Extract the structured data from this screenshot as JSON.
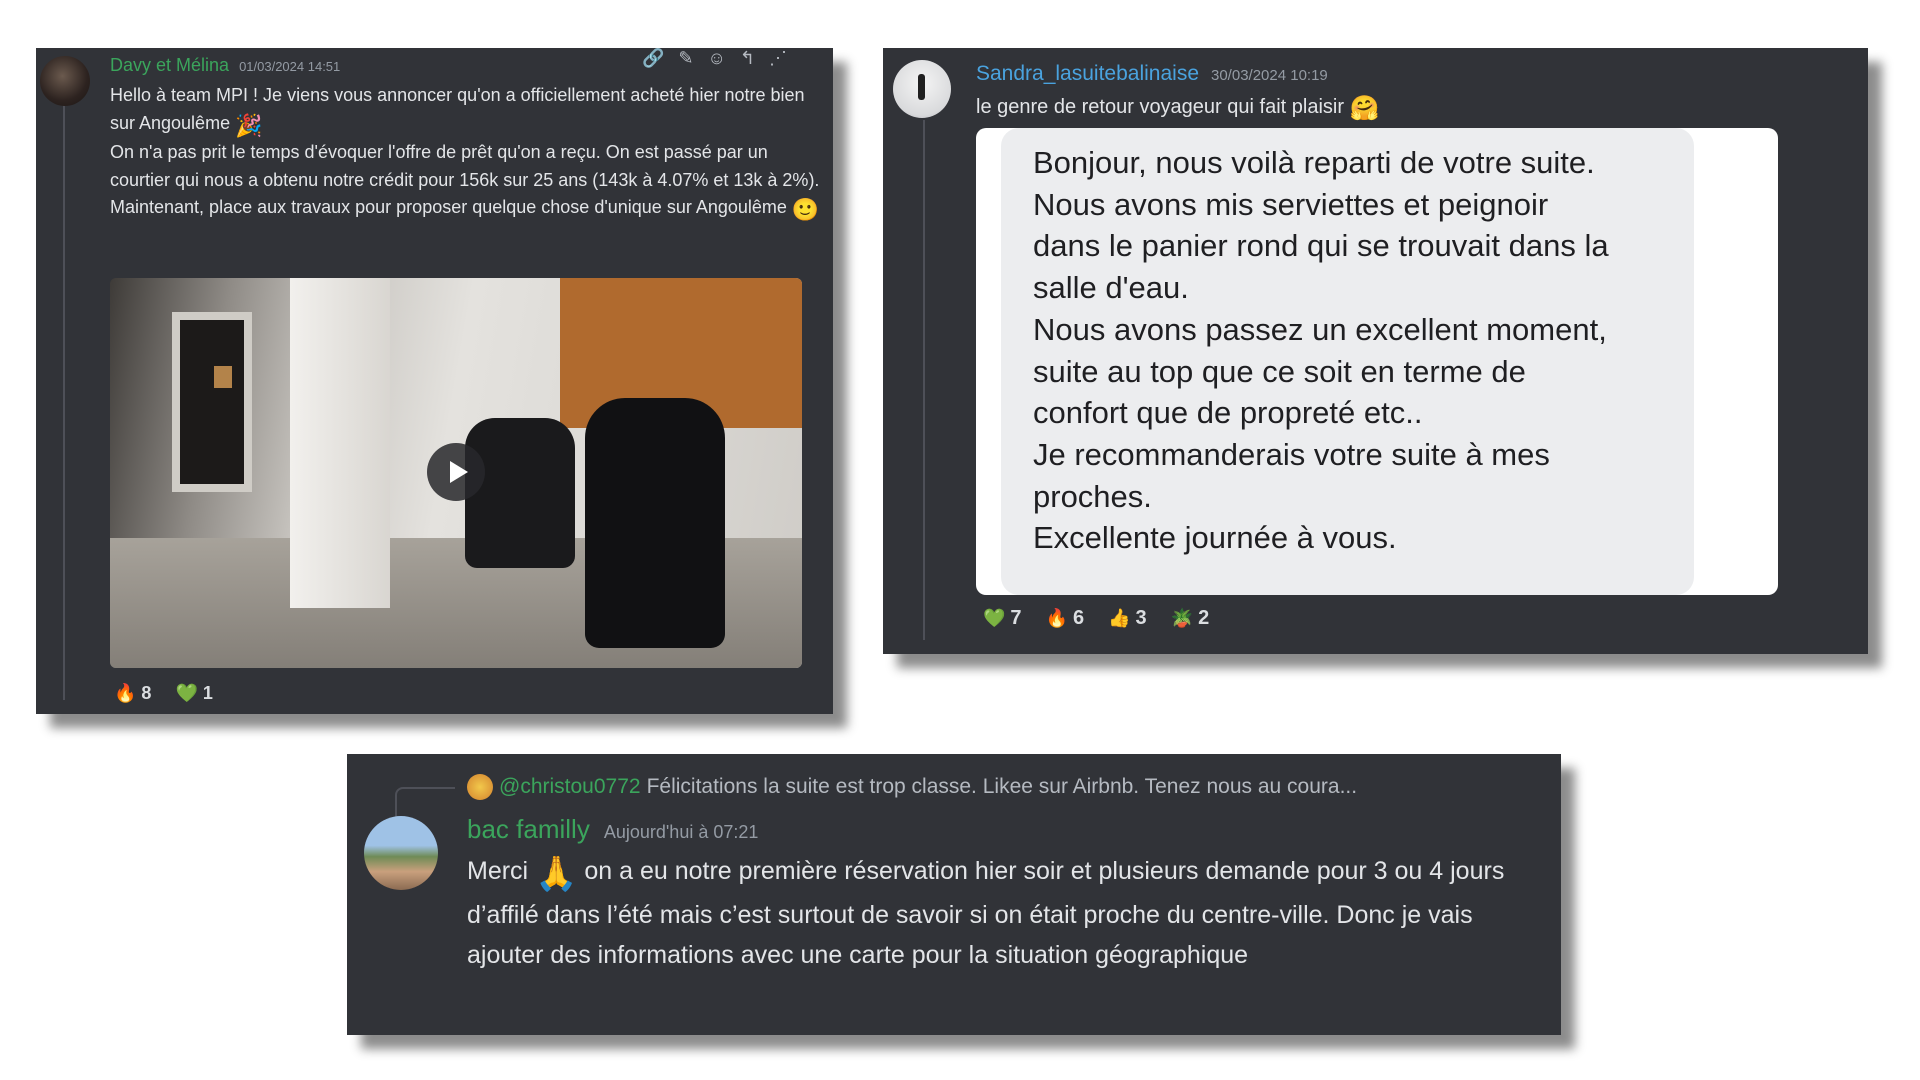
{
  "card1": {
    "author": "Davy et Mélina",
    "timestamp": "01/03/2024 14:51",
    "paragraphs": [
      "Hello à team MPI ! Je viens vous annoncer qu'on a officiellement acheté hier notre bien sur Angoulême",
      "On n'a pas prit le temps d'évoquer l'offre de prêt qu'on a reçu. On est passé par un courtier qui nous a obtenu notre crédit pour 156k sur 25 ans (143k à 4.07% et 13k à 2%).",
      "Maintenant, place aux travaux pour proposer quelque chose d'unique sur Angoulême"
    ],
    "emoji_party": "🎉",
    "emoji_smile": "🙂",
    "hover_icons": [
      "link-icon",
      "thread-icon",
      "emoji-icon",
      "reply-icon",
      "more-icon"
    ],
    "reactions": [
      {
        "emoji": "🔥",
        "count": "8"
      },
      {
        "emoji": "💚",
        "count": "1"
      }
    ]
  },
  "card2": {
    "author": "Sandra_lasuitebalinaise",
    "timestamp": "30/03/2024 10:19",
    "text": "le genre de retour voyageur qui fait plaisir",
    "emoji": "🤗",
    "quoted_message": "Bonjour, nous voilà reparti de votre suite.\nNous avons mis serviettes et peignoir\ndans le panier rond qui se trouvait dans la\nsalle d'eau.\nNous avons passez un excellent moment,\nsuite au top que ce soit en terme de\nconfort que de propreté etc..\nJe recommanderais votre suite à mes\nproches.\nExcellente journée à vous.",
    "reactions": [
      {
        "emoji": "💚",
        "count": "7"
      },
      {
        "emoji": "🔥",
        "count": "6"
      },
      {
        "emoji": "👍",
        "count": "3"
      },
      {
        "emoji": "🪴",
        "count": "2"
      }
    ]
  },
  "card3": {
    "reply_mention": "@christou0772",
    "reply_snippet": "Félicitations la suite est trop classe. Likee sur Airbnb. Tenez nous au coura...",
    "author": "bac familly",
    "timestamp": "Aujourd'hui à 07:21",
    "text_before": "Merci",
    "emoji": "🙏",
    "text_after": "on a eu notre première réservation hier soir et plusieurs demande pour 3 ou 4 jours d’affilé dans l’été mais c’est surtout de savoir si on était proche du centre-ville. Donc je vais ajouter des informations avec une carte pour la situation géographique"
  }
}
